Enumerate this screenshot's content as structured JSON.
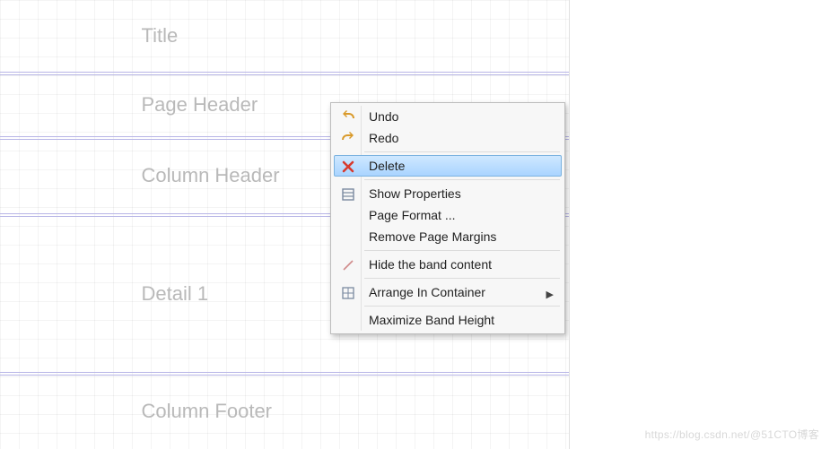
{
  "bands": {
    "title": "Title",
    "page_header": "Page Header",
    "column_header": "Column Header",
    "detail": "Detail 1",
    "column_footer": "Column Footer"
  },
  "menu": {
    "undo": "Undo",
    "redo": "Redo",
    "delete": "Delete",
    "show_properties": "Show Properties",
    "page_format": "Page Format ...",
    "remove_margins": "Remove Page Margins",
    "hide_band": "Hide the band content",
    "arrange": "Arrange In Container",
    "maximize": "Maximize Band Height"
  },
  "watermark": "https://blog.csdn.net/@51CTO博客"
}
